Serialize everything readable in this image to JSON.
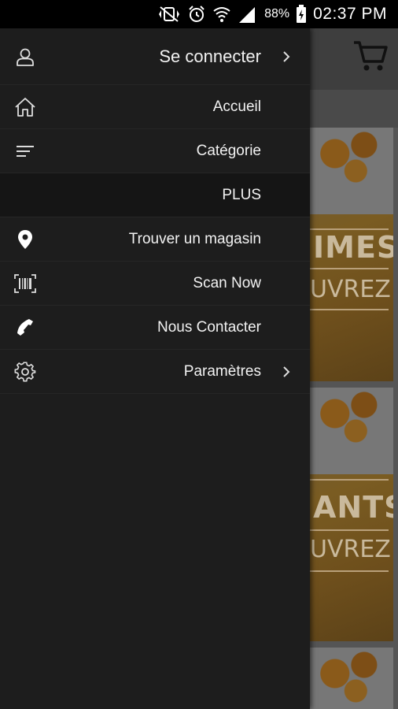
{
  "status_bar": {
    "battery_percent": "88%",
    "time": "02:37 PM",
    "icons": [
      "vibrate-off-icon",
      "alarm-icon",
      "wifi-icon",
      "signal-icon",
      "battery-icon"
    ]
  },
  "background": {
    "cart_icon": "cart-icon",
    "banners": [
      {
        "text_line1": "IMES",
        "text_line2": "UVREZ"
      },
      {
        "text_line1": "ANTS",
        "text_line2": "UVREZ"
      }
    ]
  },
  "drawer": {
    "items": [
      {
        "label": "Se connecter",
        "icon": "user-icon",
        "has_chevron": true
      },
      {
        "label": "Accueil",
        "icon": "home-icon",
        "has_chevron": false
      },
      {
        "label": "Catégorie",
        "icon": "list-icon",
        "has_chevron": false
      },
      {
        "label": "PLUS",
        "icon": "",
        "has_chevron": false,
        "highlighted": true
      },
      {
        "label": "Trouver un magasin",
        "icon": "location-pin-icon",
        "has_chevron": false
      },
      {
        "label": "Scan Now",
        "icon": "barcode-icon",
        "has_chevron": false
      },
      {
        "label": "Nous Contacter",
        "icon": "phone-icon",
        "has_chevron": false
      },
      {
        "label": "Paramètres",
        "icon": "gear-icon",
        "has_chevron": true
      }
    ]
  },
  "colors": {
    "drawer_bg": "#1d1d1d",
    "highlight_bg": "#151515",
    "text": "#f2f2f2"
  }
}
